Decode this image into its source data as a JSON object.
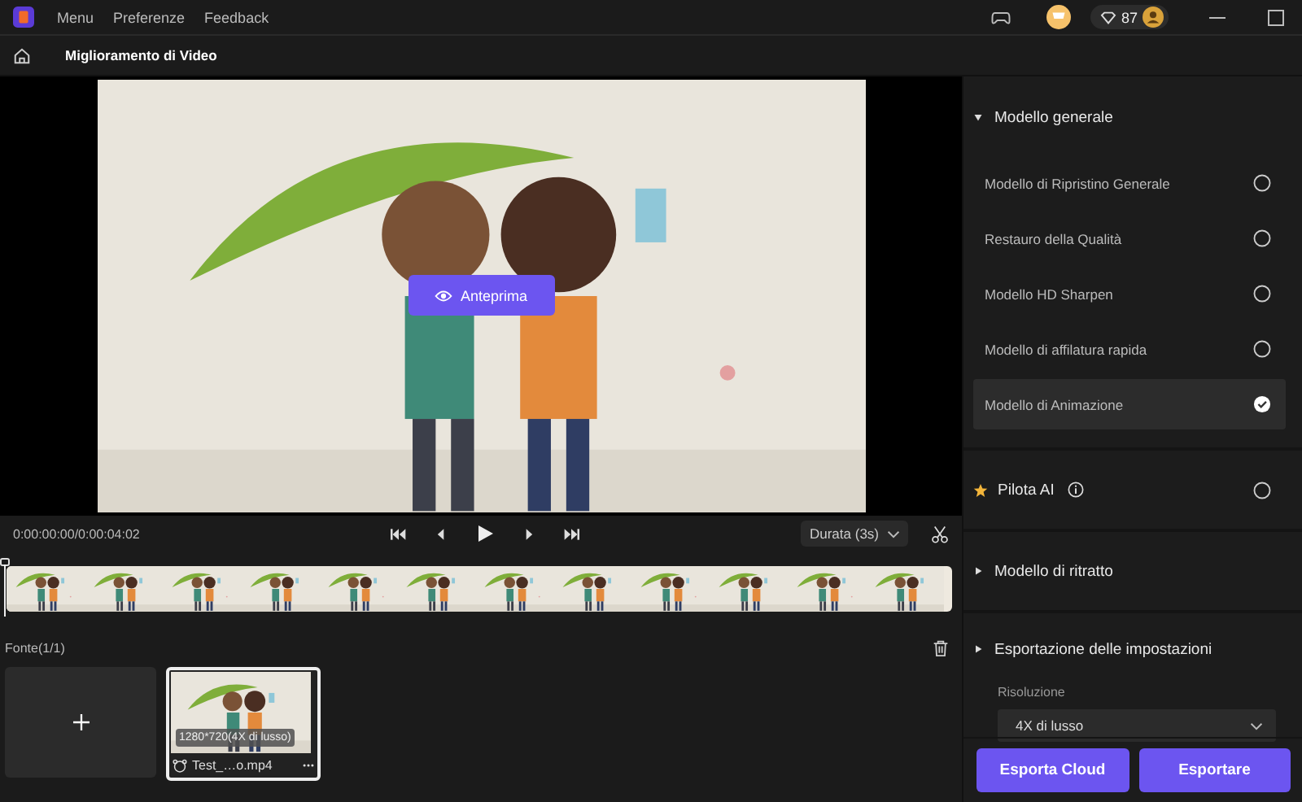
{
  "menu": [
    "Menu",
    "Preferenze",
    "Feedback"
  ],
  "credits": "87",
  "page_title": "Miglioramento di Video",
  "preview_button": "Anteprima",
  "player": {
    "time": "0:00:00:00/0:00:04:02",
    "duration": "Durata (3s)"
  },
  "source": {
    "title": "Fonte(1/1)",
    "files": [
      {
        "resolution": "1280*720(4X di lusso)",
        "name": "Test_…o.mp4",
        "selected": true
      }
    ]
  },
  "sections": [
    {
      "kind": "models",
      "title": "Modello generale",
      "expanded": true,
      "items": [
        {
          "label": "Modello di Ripristino Generale",
          "selected": false
        },
        {
          "label": "Restauro della Qualità",
          "selected": false
        },
        {
          "label": "Modello HD Sharpen",
          "selected": false
        },
        {
          "label": "Modello di affilatura rapida",
          "selected": false
        },
        {
          "label": "Modello di Animazione",
          "selected": true
        }
      ]
    },
    {
      "kind": "pilot",
      "title": "Pilota AI",
      "selected": false
    },
    {
      "kind": "collapsible",
      "title": "Modello di ritratto",
      "expanded": false
    },
    {
      "kind": "export",
      "title": "Esportazione delle impostazioni",
      "expanded": false,
      "label": "Risoluzione",
      "value": "4X di lusso"
    }
  ],
  "buttons": [
    "Esporta Cloud",
    "Esportare"
  ]
}
